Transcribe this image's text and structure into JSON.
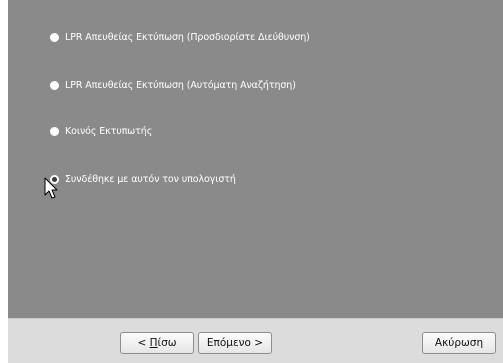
{
  "options": [
    {
      "label": "LPR Απευθείας Εκτύπωση (Προσδιορίστε Διεύθυνση)",
      "selected": false
    },
    {
      "label": "LPR Απευθείας Εκτύπωση (Αυτόματη Αναζήτηση)",
      "selected": false
    },
    {
      "label": "Κοινός Εκτυπωτής",
      "selected": false
    },
    {
      "label": "Συνδέθηκε με αυτόν τον υπολογιστή",
      "selected": true
    }
  ],
  "footer": {
    "back_prefix": "< ",
    "back_access_key": "Π",
    "back_rest": "ίσω",
    "next_label": "Επόμενο >",
    "cancel_label": "Ακύρωση"
  },
  "colors": {
    "panel_background": "#8a8a8a",
    "footer_background": "#dcdcdc",
    "option_text": "#ffffff"
  },
  "icons": {
    "cursor": "arrow-pointer-icon"
  }
}
